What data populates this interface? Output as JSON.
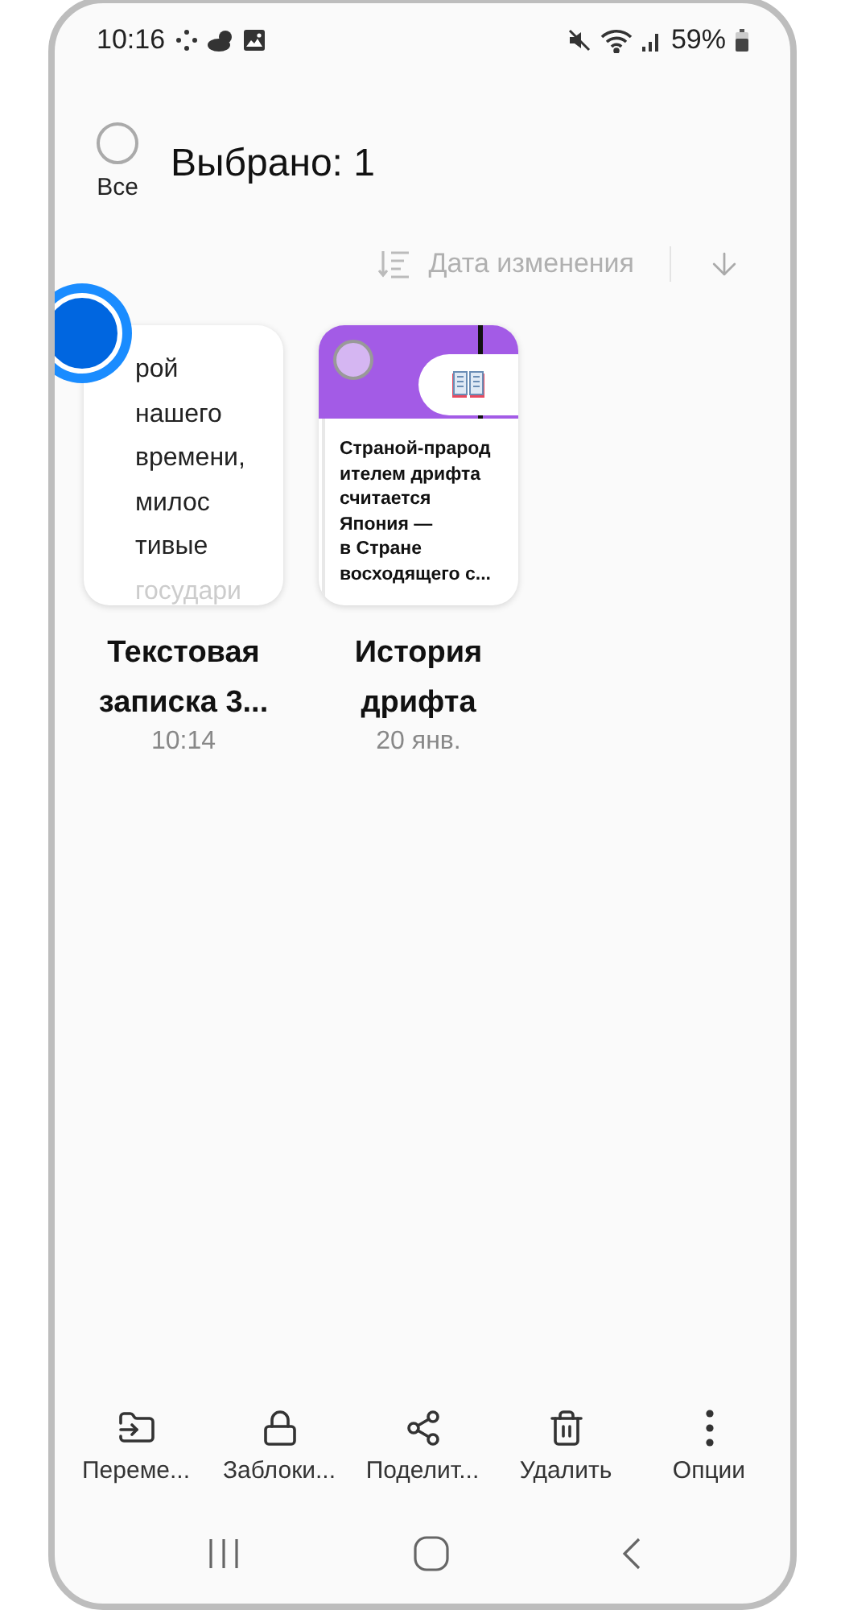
{
  "status_bar": {
    "time": "10:16",
    "battery": "59%"
  },
  "header": {
    "select_all": {
      "label": "Все",
      "checked": false
    },
    "title": "Выбрано: 1"
  },
  "sort": {
    "label": "Дата изменения"
  },
  "notes": [
    {
      "kind": "text",
      "selected": true,
      "preview_lines": [
        "рой",
        "нашего",
        "времени,",
        "милос",
        "тивые",
        "государи"
      ],
      "title": "Текстовая записка 3...",
      "date": "10:14"
    },
    {
      "kind": "cover",
      "selected": false,
      "preview_lines": [
        "Страной-прарод",
        "ителем дрифта",
        "считается",
        "Япония —",
        "в Стране",
        "восходящего с..."
      ],
      "title": "История дрифта",
      "date": "20 янв."
    }
  ],
  "toolbar": [
    {
      "kind": "move",
      "label": "Переме..."
    },
    {
      "kind": "lock",
      "label": "Заблоки..."
    },
    {
      "kind": "share",
      "label": "Поделит..."
    },
    {
      "kind": "delete",
      "label": "Удалить"
    },
    {
      "kind": "more",
      "label": "Опции"
    }
  ]
}
